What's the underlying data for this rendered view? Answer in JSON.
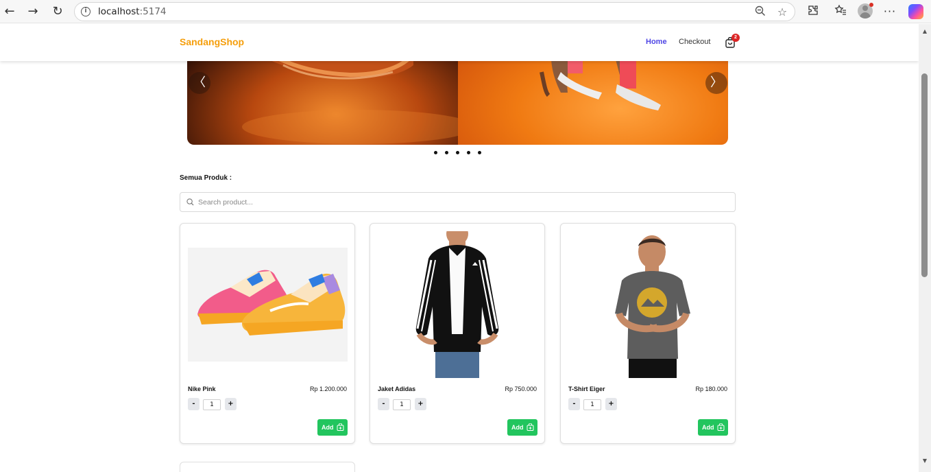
{
  "browser": {
    "url_host": "localhost",
    "url_port": ":5174"
  },
  "navbar": {
    "brand": "SandangShop",
    "links": [
      "Home",
      "Checkout"
    ],
    "cart_count": "2"
  },
  "carousel": {
    "prev_label": "〈",
    "next_label": "〉",
    "slide_count": 5
  },
  "section": {
    "title": "Semua Produk :"
  },
  "search": {
    "placeholder": "Search product..."
  },
  "products": [
    {
      "name": "Nike Pink",
      "price": "Rp 1.200.000",
      "qty": "1",
      "add_label": "Add"
    },
    {
      "name": "Jaket Adidas",
      "price": "Rp 750.000",
      "qty": "1",
      "add_label": "Add"
    },
    {
      "name": "T-Shirt Eiger",
      "price": "Rp 180.000",
      "qty": "1",
      "add_label": "Add"
    }
  ],
  "qty_controls": {
    "minus": "-",
    "plus": "+"
  },
  "colors": {
    "brand": "#f59e0b",
    "nav_active": "#4f46e5",
    "add_button": "#22c55e",
    "badge": "#dc2626"
  }
}
